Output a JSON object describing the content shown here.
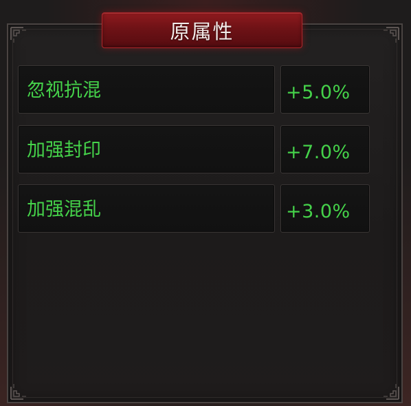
{
  "panel": {
    "title": "原属性"
  },
  "attributes": [
    {
      "name": "忽视抗混",
      "value": "+5.0%"
    },
    {
      "name": "加强封印",
      "value": "+7.0%"
    },
    {
      "name": "加强混乱",
      "value": "+3.0%"
    }
  ],
  "colors": {
    "title_plaque": "#6e1216",
    "attribute_text": "#45d24a",
    "title_text": "#f3ecea"
  }
}
